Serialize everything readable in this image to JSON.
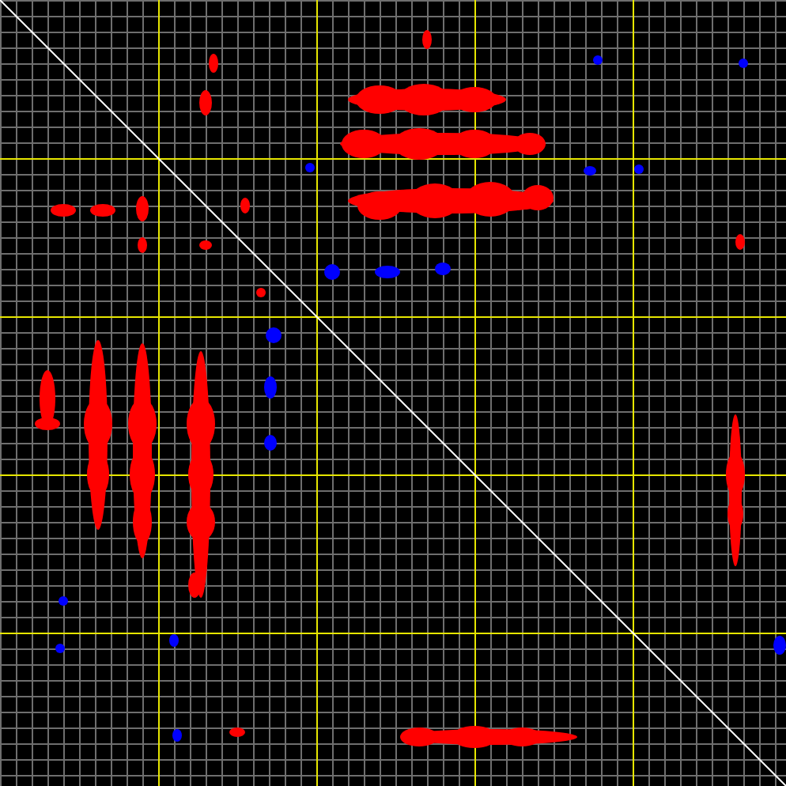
{
  "plot": {
    "kind": "contour",
    "diagonal": true
  }
}
